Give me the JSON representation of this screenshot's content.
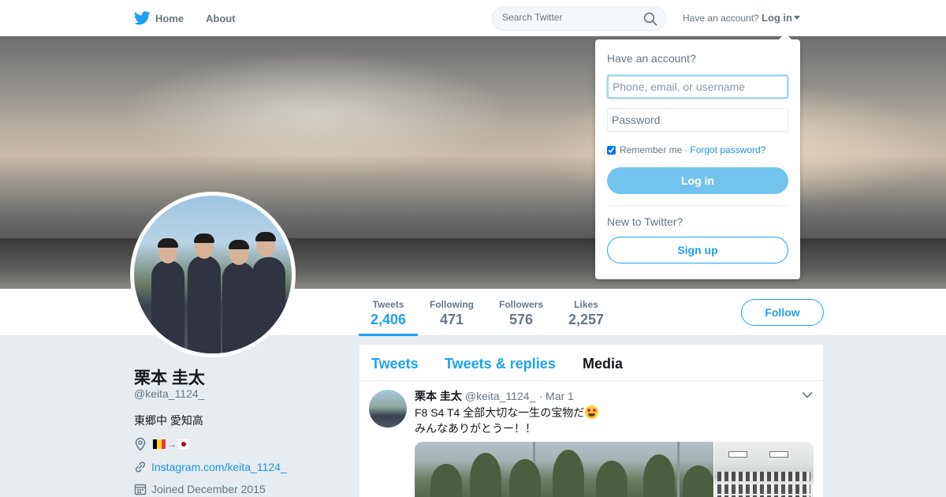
{
  "nav": {
    "home_label": "Home",
    "about_label": "About",
    "search_placeholder": "Search Twitter",
    "have_account_text": "Have an account?",
    "login_label": "Log in"
  },
  "profile": {
    "name": "栗本 圭太",
    "handle": "@keita_1124_",
    "bio": "東郷中 愛知高",
    "location_arrow": "→",
    "website": "Instagram.com/keita_1124_",
    "joined": "Joined December 2015",
    "follow_label": "Follow"
  },
  "stats": [
    {
      "label": "Tweets",
      "value": "2,406"
    },
    {
      "label": "Following",
      "value": "471"
    },
    {
      "label": "Followers",
      "value": "576"
    },
    {
      "label": "Likes",
      "value": "2,257"
    }
  ],
  "timeline": {
    "tabs": [
      "Tweets",
      "Tweets & replies",
      "Media"
    ],
    "active_tab": "Media"
  },
  "tweet": {
    "name": "栗本 圭太",
    "handle": "@keita_1124_",
    "separator": "·",
    "time": "Mar 1",
    "line1": "F8 S4 T4  全部大切な一生の宝物だ",
    "line2": "みんなありがとうー！！"
  },
  "login_dropdown": {
    "title": "Have an account?",
    "username_placeholder": "Phone, email, or username",
    "password_placeholder": "Password",
    "remember_label": "Remember me",
    "separator": "·",
    "forgot_label": "Forgot password?",
    "login_button": "Log in",
    "new_text": "New to Twitter?",
    "signup_button": "Sign up"
  },
  "colors": {
    "accent": "#1da1f2",
    "link": "#1b95e0",
    "muted": "#657786",
    "background": "#e6ecf0"
  },
  "icons": {
    "brand": "twitter-bird-icon",
    "search": "search-icon",
    "location": "map-pin-icon",
    "website": "link-icon",
    "joined": "calendar-icon",
    "tweet_menu": "chevron-down-icon"
  }
}
